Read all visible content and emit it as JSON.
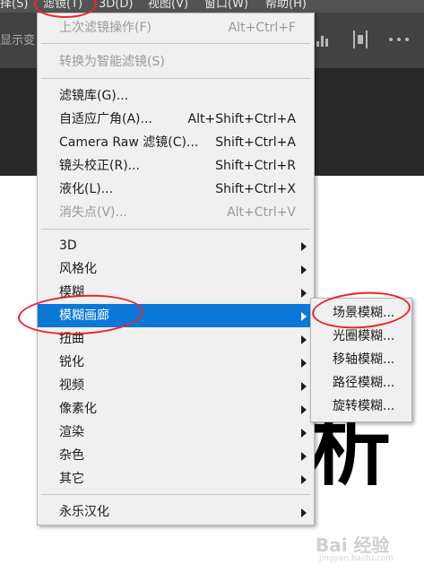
{
  "menubar": {
    "items": [
      "择(S)",
      "滤镜(T)",
      "3D(D)",
      "视图(V)",
      "窗口(W)",
      "帮助(H)"
    ]
  },
  "optionsbar": {
    "partial_text": "显示变"
  },
  "filter_menu": {
    "items": [
      {
        "label": "上次滤镜操作(F)",
        "shortcut": "Alt+Ctrl+F",
        "enabled": false
      },
      {
        "label": "转换为智能滤镜(S)",
        "shortcut": "",
        "enabled": false
      },
      {
        "label": "滤镜库(G)...",
        "shortcut": "",
        "enabled": true
      },
      {
        "label": "自适应广角(A)...",
        "shortcut": "Alt+Shift+Ctrl+A",
        "enabled": true
      },
      {
        "label": "Camera Raw 滤镜(C)...",
        "shortcut": "Shift+Ctrl+A",
        "enabled": true
      },
      {
        "label": "镜头校正(R)...",
        "shortcut": "Shift+Ctrl+R",
        "enabled": true
      },
      {
        "label": "液化(L)...",
        "shortcut": "Shift+Ctrl+X",
        "enabled": true
      },
      {
        "label": "消失点(V)...",
        "shortcut": "Alt+Ctrl+V",
        "enabled": false
      },
      {
        "label": "3D",
        "submenu": true
      },
      {
        "label": "风格化",
        "submenu": true
      },
      {
        "label": "模糊",
        "submenu": true
      },
      {
        "label": "模糊画廊",
        "submenu": true,
        "highlighted": true
      },
      {
        "label": "扭曲",
        "submenu": true
      },
      {
        "label": "锐化",
        "submenu": true
      },
      {
        "label": "视频",
        "submenu": true
      },
      {
        "label": "像素化",
        "submenu": true
      },
      {
        "label": "渲染",
        "submenu": true
      },
      {
        "label": "杂色",
        "submenu": true
      },
      {
        "label": "其它",
        "submenu": true
      },
      {
        "label": "永乐汉化",
        "submenu": true
      }
    ]
  },
  "blur_gallery_submenu": {
    "items": [
      "场景模糊...",
      "光圈模糊...",
      "移轴模糊...",
      "路径模糊...",
      "旋转模糊..."
    ]
  },
  "canvas": {
    "visible_glyph": "析"
  },
  "watermark": {
    "logo": "Bai 经验",
    "url": "jingyan.baidu.com"
  },
  "colors": {
    "menu_bg": "#f0f0f0",
    "highlight": "#0a78d7",
    "disabled_text": "#9a9a9a",
    "annotation_red": "#e8262b",
    "app_dark": "#424242"
  }
}
